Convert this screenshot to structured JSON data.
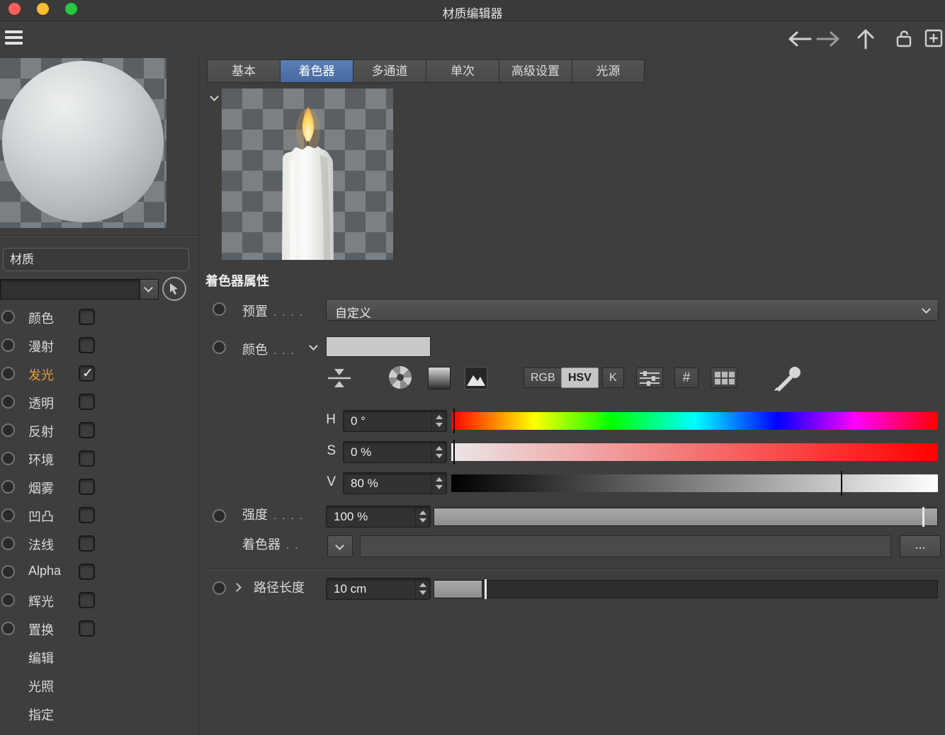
{
  "window": {
    "title": "材质编辑器"
  },
  "sidebar": {
    "material_label": "材质",
    "channels": [
      {
        "label": "颜色",
        "checked": false,
        "highlight": false
      },
      {
        "label": "漫射",
        "checked": false,
        "highlight": false
      },
      {
        "label": "发光",
        "checked": true,
        "highlight": true
      },
      {
        "label": "透明",
        "checked": false,
        "highlight": false
      },
      {
        "label": "反射",
        "checked": false,
        "highlight": false
      },
      {
        "label": "环境",
        "checked": false,
        "highlight": false
      },
      {
        "label": "烟雾",
        "checked": false,
        "highlight": false
      },
      {
        "label": "凹凸",
        "checked": false,
        "highlight": false
      },
      {
        "label": "法线",
        "checked": false,
        "highlight": false
      },
      {
        "label": "Alpha",
        "checked": false,
        "highlight": false
      },
      {
        "label": "辉光",
        "checked": false,
        "highlight": false
      },
      {
        "label": "置换",
        "checked": false,
        "highlight": false
      }
    ],
    "extra_items": [
      {
        "label": "编辑"
      },
      {
        "label": "光照"
      },
      {
        "label": "指定"
      }
    ]
  },
  "tabs": [
    {
      "label": "基本",
      "active": false
    },
    {
      "label": "着色器",
      "active": true
    },
    {
      "label": "多通道",
      "active": false
    },
    {
      "label": "单次",
      "active": false
    },
    {
      "label": "高级设置",
      "active": false
    },
    {
      "label": "光源",
      "active": false
    }
  ],
  "panel": {
    "section_title": "着色器属性",
    "preset": {
      "label": "预置",
      "dots": ". . . .",
      "value": "自定义"
    },
    "color": {
      "label": "颜色",
      "dots": ". . ."
    },
    "modes": [
      {
        "label": "RGB",
        "active": false
      },
      {
        "label": "HSV",
        "active": true
      },
      {
        "label": "K",
        "active": false
      }
    ],
    "hash_label": "#",
    "hsv": {
      "h": {
        "label": "H",
        "value": "0 °",
        "pos": 0.4
      },
      "s": {
        "label": "S",
        "value": "0 %",
        "pos": 0.4
      },
      "v": {
        "label": "V",
        "value": "80 %",
        "pos": 80
      }
    },
    "intensity": {
      "label": "强度",
      "dots": ". . . .",
      "value": "100 %",
      "fill": 100,
      "thumb": 97
    },
    "shader": {
      "label": "着色器",
      "dots": ". .",
      "more": "..."
    },
    "path_length": {
      "label": "路径长度",
      "value": "10 cm",
      "fill": 9.5,
      "thumb": 10
    }
  },
  "colors": {
    "active_tab": "#4a6da3",
    "luminance_highlight": "#e79a3c",
    "traffic_red": "#ff5f57",
    "traffic_yellow": "#febc2e",
    "traffic_green": "#28c840",
    "slider_marker": "#0b0b0b"
  }
}
